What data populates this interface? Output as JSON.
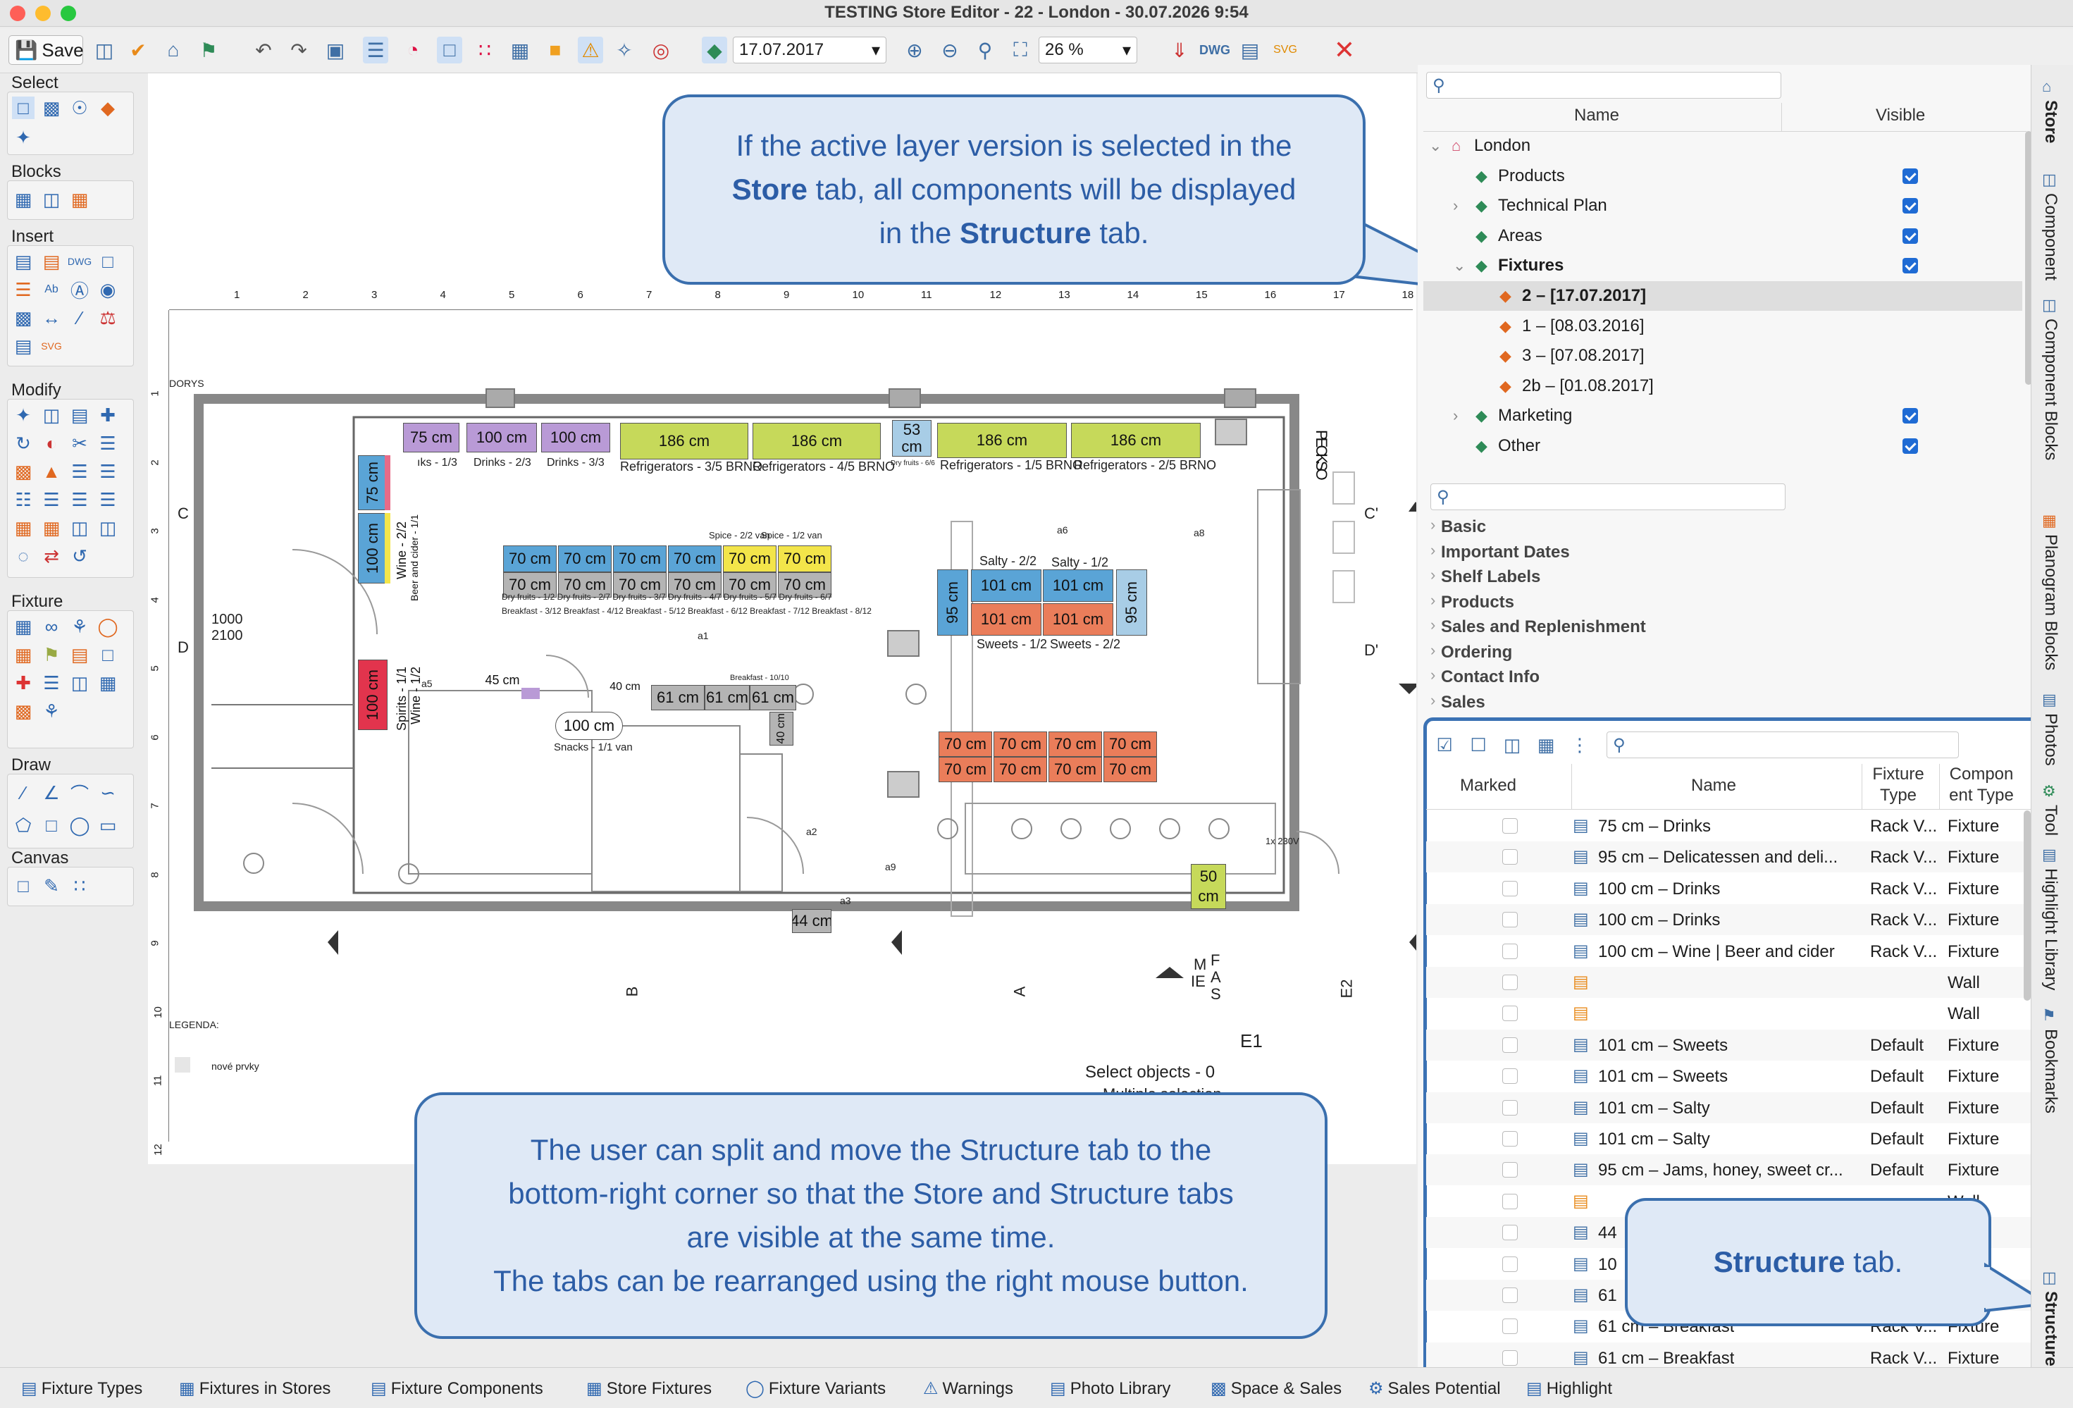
{
  "window": {
    "title": "TESTING Store Editor - 22 - London - 30.07.2026 9:54"
  },
  "toolbar": {
    "save_label": "Save",
    "date_value": "17.07.2017",
    "zoom_value": "26 %"
  },
  "left_sections": {
    "select": "Select",
    "blocks": "Blocks",
    "insert": "Insert",
    "modify": "Modify",
    "fixture": "Fixture",
    "draw": "Draw",
    "canvas": "Canvas"
  },
  "ruler": {
    "h": [
      "1",
      "2",
      "3",
      "4",
      "5",
      "6",
      "7",
      "8",
      "9",
      "10",
      "11",
      "12",
      "13",
      "14",
      "15",
      "16",
      "17",
      "18"
    ],
    "v": [
      "1",
      "2",
      "3",
      "4",
      "5",
      "6",
      "7",
      "8",
      "9",
      "10",
      "11",
      "12"
    ]
  },
  "plan": {
    "top_fixtures": [
      "75 cm",
      "100 cm",
      "100 cm",
      "186 cm",
      "186 cm",
      "53 cm",
      "186 cm",
      "186 cm"
    ],
    "top_labels": [
      "ıks - 1/3",
      "Drinks - 2/3",
      "Drinks - 3/3",
      "Refrigerators - 3/5 BRNO",
      "Refrigerators - 4/5 BRNO",
      "Dry fruits - 6/6",
      "Refrigerators - 1/5 BRNO",
      "Refrigerators - 2/5 BRNO"
    ],
    "left_fixtures": [
      "75 cm",
      "100 cm",
      "100 cm"
    ],
    "left_labels": [
      "Wine - 2/2",
      "Beer and cider - 1/1",
      "Spirits - 1/1",
      "Wine - 1/2"
    ],
    "mid_row1": [
      "70 cm",
      "70 cm",
      "70 cm",
      "70 cm",
      "70 cm",
      "70 cm"
    ],
    "mid_row2": [
      "70 cm",
      "70 cm",
      "70 cm",
      "70 cm",
      "70 cm",
      "70 cm"
    ],
    "mid_label_spice": "Spice - 2/2 van",
    "mid_label_spice2": "Spice - 1/2 van",
    "mid_dry": "Dry fruits - 1/2  Dry fruits - 2/7  Dry fruits - 3/7  Dry fruits - 4/7  Dry fruits - 5/7  Dry fruits - 6/7",
    "mid_breakfast": "Breakfast - 3/12  Breakfast - 4/12  Breakfast - 5/12  Breakfast - 6/12  Breakfast - 7/12  Breakfast - 8/12",
    "salty_labels": [
      "Salty - 2/2",
      "Salty - 1/2"
    ],
    "salty": [
      "101 cm",
      "101 cm"
    ],
    "sweets": [
      "101 cm",
      "101 cm"
    ],
    "sweets_labels": [
      "Sweets - 1/2",
      "Sweets - 2/2"
    ],
    "side95": [
      "95 cm",
      "95 cm"
    ],
    "coffee_row1": [
      "70 cm",
      "70 cm",
      "70 cm",
      "70 cm"
    ],
    "coffee_row2": [
      "70 cm",
      "70 cm",
      "70 cm",
      "70 cm"
    ],
    "small_fixtures": [
      "45 cm",
      "40 cm",
      "100 cm",
      "61 cm",
      "61 cm",
      "61 cm",
      "40 cm",
      "44 cm",
      "50 cm"
    ],
    "snacks": "Snacks - 1/1 van",
    "breakfast_lbl": "Breakfast - 10/10",
    "letters": [
      "C",
      "D",
      "B",
      "A",
      "E2",
      "E1",
      "C'",
      "D'"
    ],
    "circles": [
      "a6",
      "a8",
      "a1",
      "a5",
      "a2",
      "a9",
      "a3"
    ],
    "side_text": "PECKSO",
    "left_side_text": "1000 2100",
    "dorys": "DORYS",
    "legend": "LEGENDA:",
    "legend_item": "nové prvky",
    "select_objects": "Select objects - 0",
    "multiple": "Multiple selection",
    "misc": [
      "1x 230V",
      "M",
      "IE",
      "F",
      "A",
      "S"
    ]
  },
  "callouts": {
    "top": [
      "If the active layer version is selected in the",
      "Store",
      "tab, all components will be displayed",
      "in the",
      "Structure",
      "tab."
    ],
    "bottom": [
      "The user can split and move the Structure tab to the",
      "bottom-right corner so that the Store and Structure tabs",
      "are visible at the same time.",
      "The tabs can be rearranged using the right mouse button."
    ],
    "small": [
      "Structure",
      "tab."
    ]
  },
  "store_tree": {
    "col_name": "Name",
    "col_visible": "Visible",
    "rows": [
      "London",
      "Products",
      "Technical Plan",
      "Areas",
      "Fixtures",
      "2 – [17.07.2017]",
      "1 – [08.03.2016]",
      "3 – [07.08.2017]",
      "2b – [01.08.2017]",
      "Marketing",
      "Other"
    ]
  },
  "categories": [
    "Basic",
    "Important Dates",
    "Shelf Labels",
    "Products",
    "Sales and Replenishment",
    "Ordering",
    "Contact Info",
    "Sales"
  ],
  "structure": {
    "headers": [
      "Marked",
      "Name",
      "Fixture",
      "Type",
      "Compon",
      "ent Type"
    ],
    "rows": [
      {
        "name": "75 cm – Drinks",
        "ftype": "Rack V...",
        "ctype": "Fixture"
      },
      {
        "name": "95 cm – Delicatessen and deli...",
        "ftype": "Rack V...",
        "ctype": "Fixture"
      },
      {
        "name": "100 cm – Drinks",
        "ftype": "Rack V...",
        "ctype": "Fixture"
      },
      {
        "name": "100 cm – Drinks",
        "ftype": "Rack V...",
        "ctype": "Fixture"
      },
      {
        "name": "100 cm – Wine | Beer and cider",
        "ftype": "Rack V...",
        "ctype": "Fixture"
      },
      {
        "name": "",
        "ftype": "",
        "ctype": "Wall"
      },
      {
        "name": "",
        "ftype": "",
        "ctype": "Wall"
      },
      {
        "name": "101 cm – Sweets",
        "ftype": "Default",
        "ctype": "Fixture"
      },
      {
        "name": "101 cm – Sweets",
        "ftype": "Default",
        "ctype": "Fixture"
      },
      {
        "name": "101 cm – Salty",
        "ftype": "Default",
        "ctype": "Fixture"
      },
      {
        "name": "101 cm – Salty",
        "ftype": "Default",
        "ctype": "Fixture"
      },
      {
        "name": "95 cm – Jams, honey, sweet cr...",
        "ftype": "Default",
        "ctype": "Fixture"
      },
      {
        "name": "",
        "ftype": "",
        "ctype": "Wall"
      },
      {
        "name": "44",
        "ftype": "",
        "ctype": "ture"
      },
      {
        "name": "10",
        "ftype": "",
        "ctype": "ture"
      },
      {
        "name": "61",
        "ftype": "",
        "ctype": ""
      },
      {
        "name": "61 cm – Breakfast",
        "ftype": "Rack V...",
        "ctype": "Fixture"
      },
      {
        "name": "61 cm – Breakfast",
        "ftype": "Rack V...",
        "ctype": "Fixture"
      }
    ]
  },
  "vtabs": [
    "Store",
    "Component",
    "Component Blocks",
    "Planogram Blocks",
    "Photos",
    "Tool",
    "Highlight Library",
    "Bookmarks",
    "Structure"
  ],
  "bottom_tabs": [
    "Fixture Types",
    "Fixtures in Stores",
    "Fixture Components",
    "Store Fixtures",
    "Fixture Variants",
    "Warnings",
    "Photo Library",
    "Space & Sales",
    "Sales Potential",
    "Highlight"
  ],
  "colors": {
    "accent": "#3a6fae",
    "callout_bg": "#dfe9f6",
    "purple": "#b99ad6",
    "green": "#c6d95a",
    "blue": "#5aa4d6",
    "lightblue": "#a8cde6",
    "yellow": "#f3e54a",
    "salmon": "#ea7d5a",
    "red": "#e2344d",
    "grey": "#b4b4b4"
  }
}
